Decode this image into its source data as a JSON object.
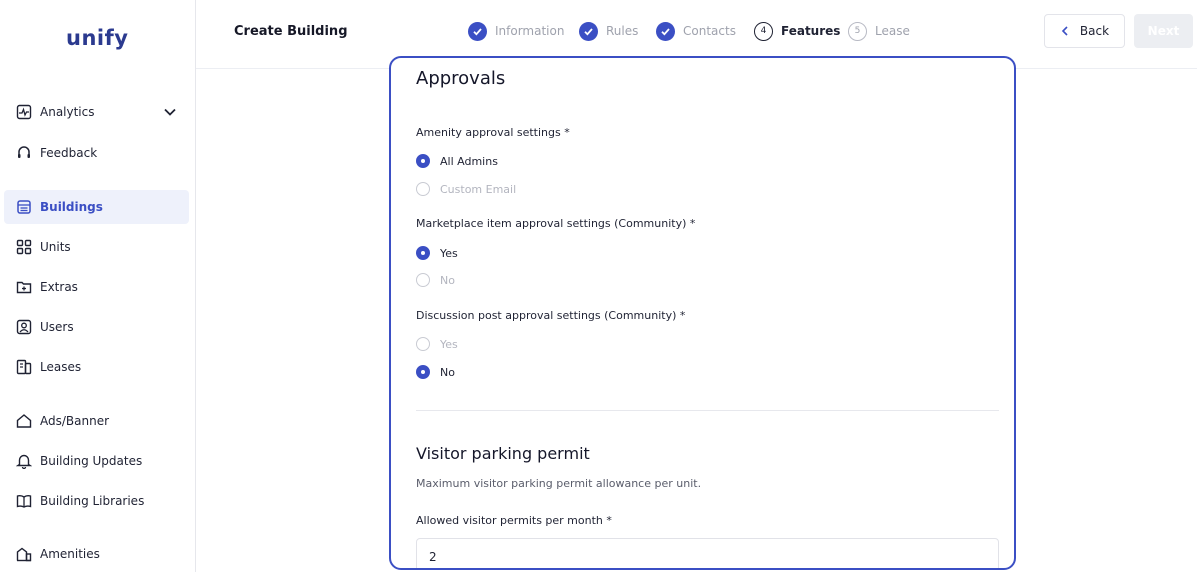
{
  "app": {
    "logo": "unify"
  },
  "sidebar": {
    "items": [
      {
        "label": "Analytics",
        "icon": "analytics-icon"
      },
      {
        "label": "Feedback",
        "icon": "feedback-icon"
      },
      {
        "label": "Buildings",
        "icon": "building-icon",
        "active": true
      },
      {
        "label": "Units",
        "icon": "grid-icon"
      },
      {
        "label": "Extras",
        "icon": "folder-plus-icon"
      },
      {
        "label": "Users",
        "icon": "user-icon"
      },
      {
        "label": "Leases",
        "icon": "lease-icon"
      },
      {
        "label": "Ads/Banner",
        "icon": "tag-icon"
      },
      {
        "label": "Building Updates",
        "icon": "bell-icon"
      },
      {
        "label": "Building Libraries",
        "icon": "book-icon"
      },
      {
        "label": "Amenities",
        "icon": "amenities-icon"
      }
    ]
  },
  "header": {
    "title": "Create Building",
    "steps": [
      {
        "label": "Information",
        "state": "done"
      },
      {
        "label": "Rules",
        "state": "done"
      },
      {
        "label": "Contacts",
        "state": "done"
      },
      {
        "label": "Features",
        "number": "4",
        "state": "current"
      },
      {
        "label": "Lease",
        "number": "5",
        "state": "pending"
      }
    ],
    "back_label": "Back",
    "next_label": "Next"
  },
  "approvals": {
    "title": "Approvals",
    "amenity": {
      "label": "Amenity approval settings *",
      "options": [
        "All Admins",
        "Custom Email"
      ],
      "selected": "All Admins"
    },
    "marketplace": {
      "label": "Marketplace item approval settings (Community) *",
      "options": [
        "Yes",
        "No"
      ],
      "selected": "Yes"
    },
    "discussion": {
      "label": "Discussion post approval settings (Community) *",
      "options": [
        "Yes",
        "No"
      ],
      "selected": "No"
    }
  },
  "visitor_parking": {
    "title": "Visitor parking permit",
    "description": "Maximum visitor parking permit allowance per unit.",
    "field_label": "Allowed visitor permits per month *",
    "value": "2"
  },
  "colors": {
    "accent": "#3b4fc4",
    "brand": "#2b3a8f"
  }
}
